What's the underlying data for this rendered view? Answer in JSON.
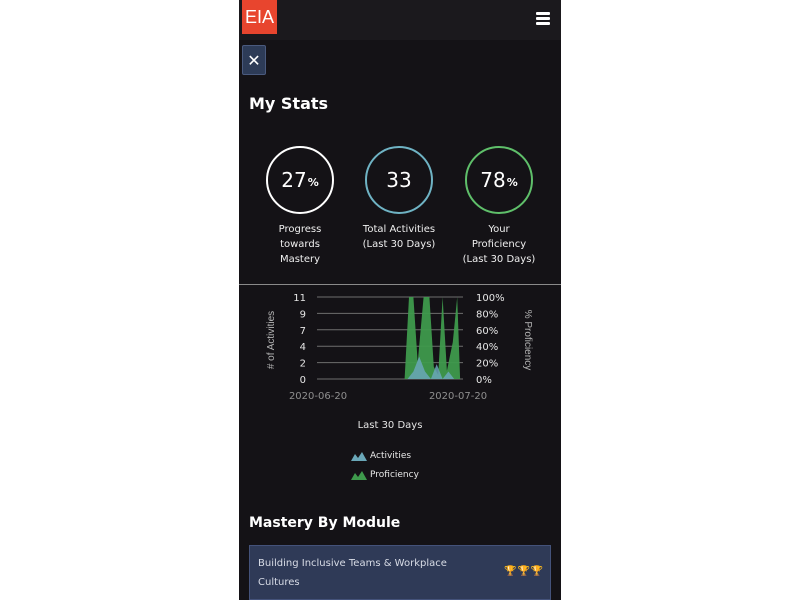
{
  "header": {
    "logo_text": "EIA",
    "logo_color": "#e8452e",
    "menu_icon": "hamburger-menu-icon"
  },
  "close_button": {
    "label": "✕",
    "icon": "close-icon"
  },
  "stats": {
    "title": "My Stats",
    "items": [
      {
        "value": "27",
        "unit": "%",
        "label_lines": [
          "Progress",
          "towards",
          "Mastery"
        ],
        "ring_color": "#ffffff"
      },
      {
        "value": "33",
        "unit": "",
        "label_lines": [
          "Total Activities",
          "(Last 30 Days)"
        ],
        "ring_color": "#6fb3c4"
      },
      {
        "value": "78",
        "unit": "%",
        "label_lines": [
          "Your",
          "Proficiency",
          "(Last 30 Days)"
        ],
        "ring_color": "#5fbf6a"
      }
    ]
  },
  "chart_data": {
    "type": "area",
    "left_axis": {
      "label": "# of Activities",
      "ticks": [
        "11",
        "9",
        "7",
        "4",
        "2",
        "0"
      ],
      "range": [
        0,
        11
      ]
    },
    "right_axis": {
      "label": "% Proficiency",
      "ticks": [
        "100%",
        "80%",
        "60%",
        "40%",
        "20%",
        "0%"
      ],
      "range": [
        0,
        100
      ]
    },
    "x_ticks": [
      "2020-06-20",
      "2020-07-20"
    ],
    "xlabel": "Last 30 Days",
    "series": [
      {
        "name": "Activities",
        "color": "#6aa7b8",
        "axis": "left",
        "points": [
          [
            0.62,
            0
          ],
          [
            0.66,
            1
          ],
          [
            0.7,
            3
          ],
          [
            0.74,
            1
          ],
          [
            0.78,
            0
          ],
          [
            0.82,
            2
          ],
          [
            0.86,
            0
          ],
          [
            0.9,
            1
          ],
          [
            0.94,
            0
          ]
        ]
      },
      {
        "name": "Proficiency",
        "color": "#3e9a4c",
        "axis": "right",
        "points": [
          [
            0.6,
            0
          ],
          [
            0.63,
            100
          ],
          [
            0.66,
            100
          ],
          [
            0.69,
            20
          ],
          [
            0.73,
            100
          ],
          [
            0.77,
            100
          ],
          [
            0.8,
            15
          ],
          [
            0.83,
            5
          ],
          [
            0.86,
            100
          ],
          [
            0.89,
            10
          ],
          [
            0.93,
            45
          ],
          [
            0.96,
            100
          ],
          [
            0.98,
            0
          ]
        ]
      }
    ],
    "legend": [
      "Activities",
      "Proficiency"
    ],
    "grid": true
  },
  "mastery": {
    "title": "Mastery By Module",
    "modules": [
      {
        "name": "Building Inclusive Teams & Workplace Cultures",
        "trophies": "🏆🏆🏆"
      }
    ]
  }
}
